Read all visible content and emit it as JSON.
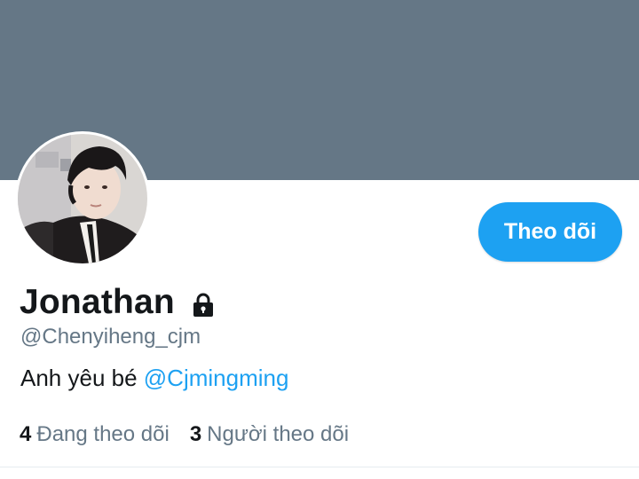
{
  "profile": {
    "display_name": "Jonathan",
    "handle": "@Chenyiheng_cjm",
    "protected_icon": "lock-icon",
    "bio_text": "Anh yêu bé ",
    "bio_mention": "@Cjmingming",
    "follow_button_label": "Theo dõi"
  },
  "stats": {
    "following_count": "4",
    "following_label": "Đang theo dõi",
    "followers_count": "3",
    "followers_label": "Người theo dõi"
  },
  "colors": {
    "banner": "#657786",
    "accent": "#1da1f2",
    "text_primary": "#14171a",
    "text_secondary": "#657786"
  }
}
